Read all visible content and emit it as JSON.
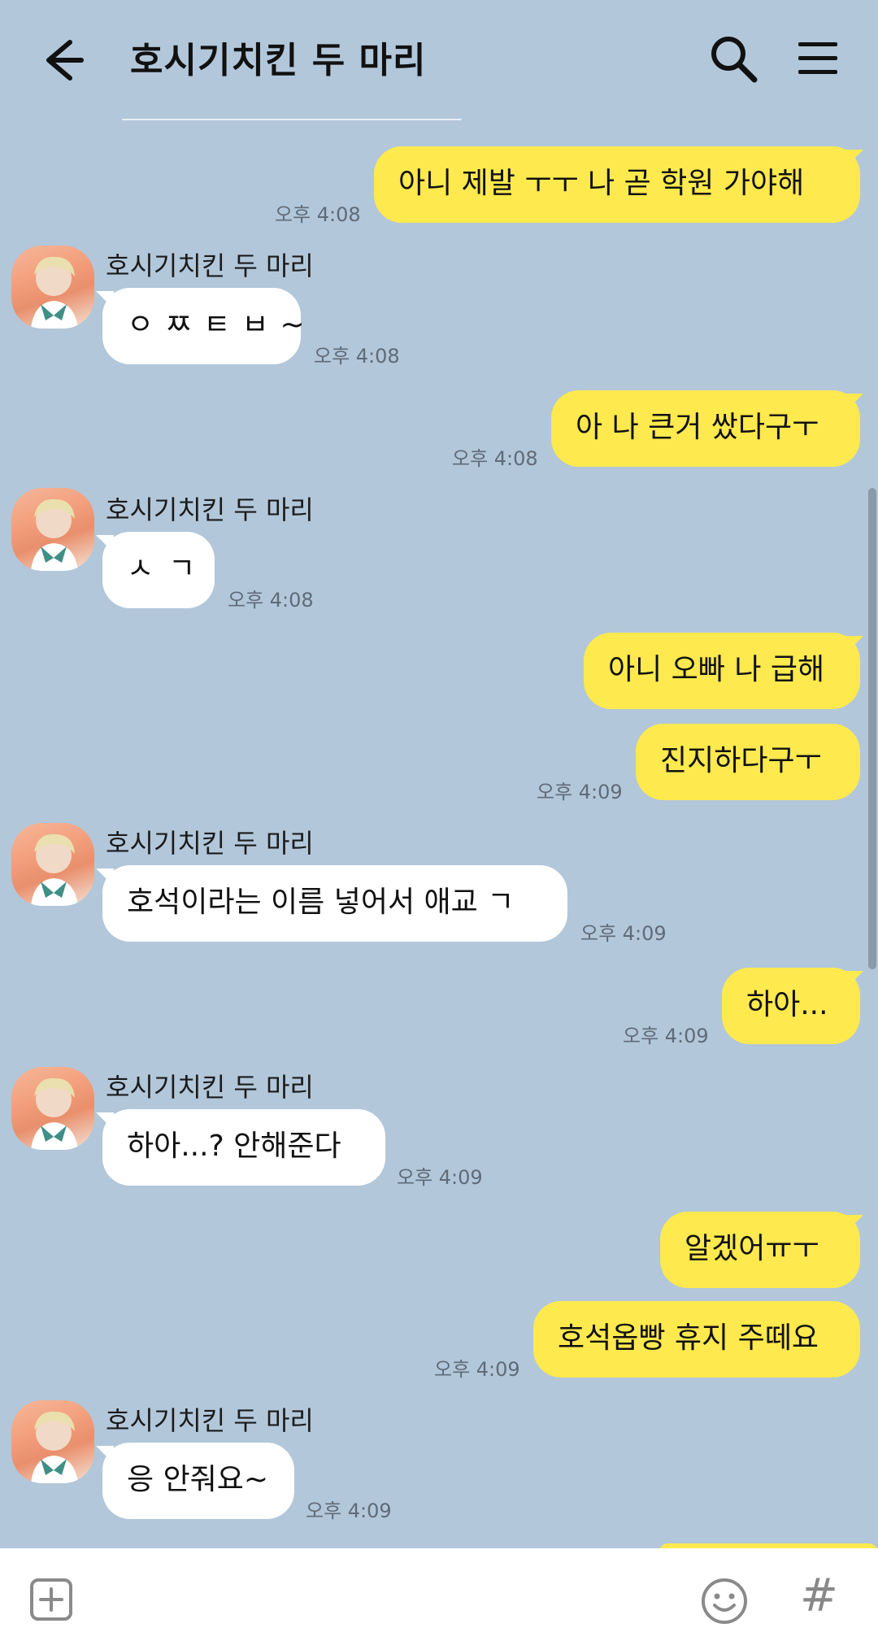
{
  "header": {
    "title": "호시기치킨 두 마리"
  },
  "colors": {
    "background": "#b2c7da",
    "outgoing_bubble": "#fee94e",
    "incoming_bubble": "#ffffff"
  },
  "messages": [
    {
      "dir": "out",
      "text": "아니 제발 ㅜㅜ 나 곧 학원 가야해",
      "time": "오후 4:08"
    },
    {
      "dir": "in",
      "sender": "호시기치킨 두 마리",
      "text": "ㅇㅉㅌㅂ~",
      "time": "오후 4:08"
    },
    {
      "dir": "out",
      "text": "아 나 큰거 쌌다구ㅜ",
      "time": "오후 4:08"
    },
    {
      "dir": "in",
      "sender": "호시기치킨 두 마리",
      "text": "ㅅㄱ",
      "time": "오후 4:08"
    },
    {
      "dir": "out",
      "text": "아니 오빠 나 급해",
      "time": ""
    },
    {
      "dir": "out",
      "text": "진지하다구ㅜ",
      "time": "오후 4:09"
    },
    {
      "dir": "in",
      "sender": "호시기치킨 두 마리",
      "text": "호석이라는 이름 넣어서 애교 ㄱ",
      "time": "오후 4:09"
    },
    {
      "dir": "out",
      "text": "하아...",
      "time": "오후 4:09"
    },
    {
      "dir": "in",
      "sender": "호시기치킨 두 마리",
      "text": "하아...? 안해준다",
      "time": "오후 4:09"
    },
    {
      "dir": "out",
      "text": "알겠어ㅠㅜ",
      "time": ""
    },
    {
      "dir": "out",
      "text": "호석옵빵 휴지 주떼요",
      "time": "오후 4:09"
    },
    {
      "dir": "in",
      "sender": "호시기치킨 두 마리",
      "text": "응 안줘요~",
      "time": "오후 4:09"
    }
  ],
  "input_bar": {
    "icons": [
      "plus-icon",
      "emoji-icon",
      "hash-icon"
    ],
    "hash_glyph": "#"
  }
}
